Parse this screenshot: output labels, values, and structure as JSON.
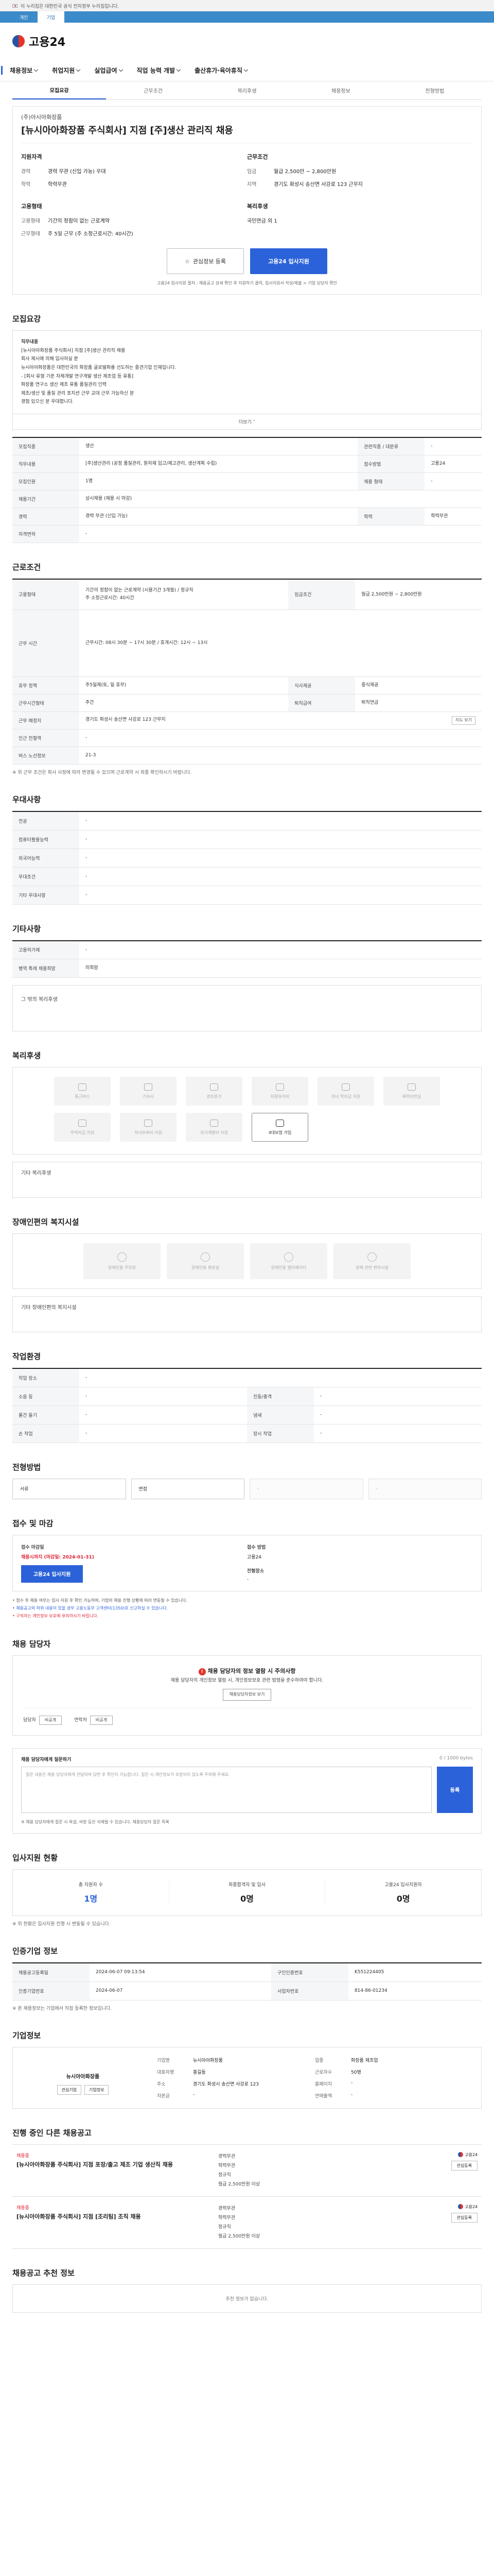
{
  "gov_banner": "이 누리집은 대한민국 공식 전자정부 누리집입니다.",
  "toggle": [
    "개인",
    "기업"
  ],
  "logo": "고용24",
  "gnb": [
    "채용정보",
    "취업지원",
    "실업급여",
    "직업 능력 개발",
    "출산휴가·육아휴직"
  ],
  "tabs": [
    "모집요강",
    "근무조건",
    "복리후생",
    "채용정보",
    "전형방법"
  ],
  "summary": {
    "company": "(주)아시아화장품",
    "title": "[뉴시아아화장품 주식회사] 지점 [주]생산 관리직 채용",
    "col1_head": "지원자격",
    "col1": [
      [
        "경력",
        "경력 무관 (신입 가능) 우대"
      ],
      [
        "학력",
        "학력무관"
      ]
    ],
    "col2_head": "근무조건",
    "col2": [
      [
        "임금",
        "월급 2,500만 ~ 2,800만원"
      ],
      [
        "지역",
        "경기도 화성시 송산면 사강로 123 근무지"
      ]
    ],
    "col3_head": "고용형태",
    "col3": [
      [
        "고용형태",
        "기간의 정함이 없는 근로계약"
      ],
      [
        "근무형태",
        "주 5일 근무 (주 소정근로시간: 40시간)"
      ]
    ],
    "col4_head": "복리후생",
    "col4": [
      [
        "",
        "국민연금 외 1"
      ]
    ],
    "scrap_btn": "관심정보 등록",
    "apply_btn": "고용24 입사지원",
    "notice": "고용24 입사지원 절차 : 채용공고 상세 확인 후 지원하기 클릭, 입사지원서 작성/제출 > 기업 담당자 확인",
    "notice_hl": "입사지원서 작성/제출"
  },
  "recruit": {
    "title": "모집요강",
    "body": [
      "직무내용",
      "[뉴시아아화장품 주식회사] 지점 [주]생산 관리직 채용",
      "회사 제시에 의해 입사하실 분",
      "뉴시아아화장품은 대한민국의 화장품 글로벌화를 선도하는 중견기업 인재입니다.",
      "- [회사 유형 기준 자체개발 연구개발 생산 제조업 등 유통]",
      "화장품 연구소 생산 제조 유통 품질관리 인력",
      "제조/생산 및 품질 관리 포지션 근무 교대 근무 가능하신 분",
      "경험 있으신 분 우대합니다."
    ],
    "more": "더보기 ˅",
    "rows": [
      [
        "모집직종",
        "생산",
        "관련직종 / 대분류",
        "-"
      ],
      [
        "직무내용",
        "[주]생산관리 (공정 품질관리, 원자재 입고/재고관리, 생산계획 수립)",
        "접수방법",
        "고용24"
      ],
      [
        "모집인원",
        "1명",
        "채용 형태",
        "-"
      ],
      [
        "채용기간",
        "상시채용 (채용 시 마감)",
        "",
        ""
      ],
      [
        "경력",
        "경력 무관 (신입 가능)",
        "학력",
        "학력무관"
      ],
      [
        "자격면허",
        "-",
        "",
        ""
      ]
    ]
  },
  "conditions": {
    "title": "근로조건",
    "rows": [
      [
        "고용형태",
        "기간의 정함이 없는 근로계약 (시용기간 3개월) / 정규직",
        "임금조건",
        "월급 2,500만원 ~ 2,800만원"
      ],
      [
        "",
        "주 소정근로시간: 40시간",
        "",
        ""
      ],
      [
        "근무 시간",
        "근무시간: 08시 30분 ~ 17시 30분 / 휴게시간: 12시 ~ 13시",
        "",
        ""
      ],
      [
        "휴무 정책",
        "주5일제(토, 일 휴무)",
        "식사제공",
        "중식제공"
      ],
      [
        "근무시간형태",
        "주간",
        "퇴직급여",
        "퇴직연금"
      ],
      [
        "근무 예정지",
        "경기도 화성시 송산면 사강로 123 근무지",
        "",
        ""
      ],
      [
        "인근 전철역",
        "-",
        "",
        ""
      ],
      [
        "버스 노선정보",
        "21-3",
        "",
        ""
      ]
    ],
    "map": "지도 보기",
    "foot": "※ 위 근무 조건은 회사 사정에 따라 변경될 수 있으며 근로계약 시 최종 확인하시기 바랍니다."
  },
  "preferences": {
    "title": "우대사항",
    "rows": [
      [
        "전공",
        "-"
      ],
      [
        "컴퓨터활용능력",
        "-"
      ],
      [
        "외국어능력",
        "-"
      ],
      [
        "우대조건",
        "-"
      ],
      [
        "기타 우대사항",
        "-"
      ]
    ]
  },
  "other": {
    "title": "기타사항",
    "rows": [
      [
        "고용허가제",
        "-"
      ],
      [
        "병역 특례 채용희망",
        "미희망"
      ]
    ],
    "box": "그 밖의 복리후생"
  },
  "benefits": {
    "title": "복리후생",
    "items": [
      "통근버스",
      "기숙사",
      "경조휴가",
      "차량유지비",
      "자녀 학자금 지원",
      "체력단련실",
      "주택자금 지원",
      "자녀보육비 지원",
      "자기계발비 지원",
      "4대보험 가입"
    ],
    "active_index": 9,
    "tag_box": "기타 복리후생"
  },
  "disability": {
    "title": "장애인편의 복지시설",
    "items": [
      "장애인용 주차장",
      "장애인용 화장실",
      "장애인용 엘리베이터",
      "장애 관련 편의시설"
    ],
    "box": "기타 장애인편의 복지시설"
  },
  "workenv": {
    "title": "작업환경",
    "rows": [
      [
        "작업 장소",
        "-",
        "",
        ""
      ],
      [
        "소음 등",
        "-",
        "진동/충격",
        "-"
      ],
      [
        "물건 들기",
        "-",
        "냄새",
        "-"
      ],
      [
        "손 작업",
        "-",
        "장시 작업",
        "-"
      ]
    ]
  },
  "selection": {
    "title": "전형방법",
    "steps": [
      "서류",
      "면접",
      "-",
      "-"
    ]
  },
  "apply": {
    "title": "접수 및 마감",
    "col1_lab": "접수 마감일",
    "col1_val": "채용시까지 (마감일: 2024-01-31)",
    "col2_lab": "접수 방법",
    "col2_val": "고용24",
    "apply_btn": "고용24 입사지원",
    "col3_lab": "전형장소",
    "col3_val": "-",
    "bullets": [
      "접수 후 채용 여부는 입사 지원 후 확인 가능하며, 기업의 채용 진행 상황에 따라 변동될 수 있습니다.",
      "채용공고의 허위 내용이 있을 경우 고용노동부 고객센터(1350)로 신고하실 수 있습니다.",
      "구직자는 개인정보 보호에 유의하시기 바랍니다."
    ]
  },
  "manager": {
    "title": "채용 담당자",
    "alert_title": "채용 담당자의 정보 열람 시 주의사항",
    "alert_body": "채용 담당자의 개인정보 열람 시, 개인정보보호 관련 법령을 준수하여야 합니다.",
    "view_btn": "채용담당자정보 보기",
    "contact_lab1": "담당자",
    "contact_lab2": "연락처",
    "contact_pill": "비공개"
  },
  "inquiry": {
    "title": "채용 담당자에게 질문하기",
    "guide": "질문 내용은 채용 담당자에게 전달되며 답변 후 확인이 가능합니다. 질문 시 개인정보가 포함되지 않도록 주의해 주세요.",
    "count": "0 / 1000 bytes",
    "send": "등록",
    "foot": "※ 채용 담당자에게 질문 시 욕설, 비방 등은 삭제될 수 있습니다. 채용담당자 질문 목록"
  },
  "stats": {
    "title": "입사지원 현황",
    "items": [
      [
        "총 지원자 수",
        "1명"
      ],
      [
        "최종합격자 및 입사",
        "0명"
      ],
      [
        "고용24 입사지원자",
        "0명"
      ]
    ],
    "foot": "※ 위 현황은 입사지원 진행 시 변동될 수 있습니다."
  },
  "reginfo": {
    "title": "인증기업 정보",
    "rows": [
      [
        "채용공고등록일",
        "2024-06-07 09:13:54",
        "구인인증번호",
        "K551224405"
      ],
      [
        "인증기업번호",
        "2024-06-07",
        "사업자번호",
        "814-86-01234"
      ]
    ],
    "foot": "※ 본 채용정보는 기업에서 직접 등록한 정보입니다."
  },
  "company": {
    "title": "기업정보",
    "name": "뉴시아아화장품",
    "btns": [
      "관심기업",
      "기업정보"
    ],
    "info": [
      [
        "기업명",
        "뉴시아아화장품",
        "업종",
        "화장품 제조업"
      ],
      [
        "대표자명",
        "홍길동",
        "근로자수",
        "50명"
      ],
      [
        "주소",
        "경기도 화성시 송산면 사강로 123",
        "홈페이지",
        "-"
      ],
      [
        "자본금",
        "-",
        "연매출액",
        "-"
      ]
    ]
  },
  "related": {
    "title": "진행 중인 다른 채용공고",
    "jobs": [
      {
        "co": "채용중",
        "title": "[뉴시아아화장품 주식회사] 지점 포장/출고 제조 기업 생산직 채용",
        "meta": [
          "경력무관",
          "학력무관",
          "정규직",
          "월급 2,500만원 이상"
        ],
        "src": "고용24",
        "btn": "관심등록"
      },
      {
        "co": "채용중",
        "title": "[뉴시아아화장품 주식회사] 지점 [조리팀] 조직 채용",
        "meta": [
          "경력무관",
          "학력무관",
          "정규직",
          "월급 2,500만원 이상"
        ],
        "src": "고용24",
        "btn": "관심등록"
      }
    ]
  },
  "recent": {
    "title": "채용공고 추천 정보",
    "empty": "추천 정보가 없습니다."
  }
}
